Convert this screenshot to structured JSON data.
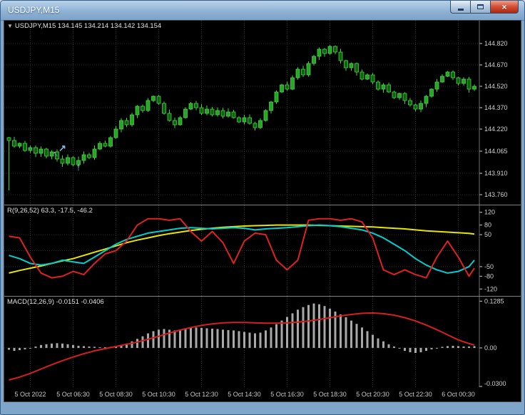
{
  "window": {
    "title": "USDJPY,M15",
    "controls": {
      "minimize": "minimize",
      "maximize": "maximize",
      "close": "close"
    }
  },
  "icons": {
    "symbol_dropdown": "▼",
    "close": "×"
  },
  "main_chart": {
    "label": "USDJPY,M15 134.145 134.214 134.142 134.154",
    "price_axis": [
      "144.820",
      "144.670",
      "144.520",
      "144.370",
      "144.220",
      "144.065",
      "143.910",
      "143.760"
    ]
  },
  "indicators": {
    "r_panel": {
      "label": "R(9,26,52) 63.3, -17.5, -46.2",
      "axis": [
        "120",
        "80",
        "50",
        "-50",
        "-80",
        "-120"
      ]
    },
    "macd_panel": {
      "label": "MACD(12,26,9) -0.0151 -0.0406",
      "axis": [
        {
          "text": "0.1285",
          "value": 0.1285
        },
        {
          "text": "0.00",
          "value": 0.0
        },
        {
          "text": "-0.0300",
          "value": -0.03,
          "pin": "bottom"
        }
      ]
    }
  },
  "time_axis": {
    "labels": [
      {
        "text": "5 Oct 2022",
        "idx": 4
      },
      {
        "text": "5 Oct 06:30",
        "idx": 12
      },
      {
        "text": "5 Oct 08:30",
        "idx": 20
      },
      {
        "text": "5 Oct 10:30",
        "idx": 28
      },
      {
        "text": "5 Oct 12:30",
        "idx": 36
      },
      {
        "text": "5 Oct 14:30",
        "idx": 44
      },
      {
        "text": "5 Oct 16:30",
        "idx": 52
      },
      {
        "text": "5 Oct 18:30",
        "idx": 60
      },
      {
        "text": "5 Oct 20:30",
        "idx": 68
      },
      {
        "text": "5 Oct 22:30",
        "idx": 76
      },
      {
        "text": "6 Oct 00:30",
        "idx": 84
      }
    ]
  },
  "chart_data": [
    {
      "type": "candlestick",
      "title": "USDJPY M15",
      "ylim": [
        143.72,
        144.96
      ],
      "open0": 144.16,
      "first_candle_low": 143.79,
      "closes": [
        144.14,
        144.1,
        144.12,
        144.07,
        144.09,
        144.05,
        144.08,
        144.03,
        144.06,
        144.01,
        143.98,
        144.02,
        143.97,
        144.0,
        144.04,
        144.02,
        144.08,
        144.12,
        144.1,
        144.16,
        144.22,
        144.28,
        144.25,
        144.32,
        144.38,
        144.35,
        144.42,
        144.45,
        144.4,
        144.33,
        144.28,
        144.25,
        144.3,
        144.36,
        144.4,
        144.37,
        144.33,
        144.36,
        144.32,
        144.35,
        144.31,
        144.34,
        144.3,
        144.27,
        144.3,
        144.26,
        144.23,
        144.28,
        144.35,
        144.41,
        144.48,
        144.53,
        144.5,
        144.58,
        144.64,
        144.6,
        144.68,
        144.73,
        144.78,
        144.75,
        144.8,
        144.76,
        144.7,
        144.65,
        144.68,
        144.62,
        144.57,
        144.6,
        144.55,
        144.5,
        144.53,
        144.48,
        144.44,
        144.47,
        144.42,
        144.39,
        144.36,
        144.4,
        144.45,
        144.5,
        144.55,
        144.59,
        144.62,
        144.58,
        144.54,
        144.57,
        144.5,
        144.52
      ],
      "markers": [
        {
          "idx": 10,
          "price": 144.065,
          "glyph": "↗",
          "rotate": 0,
          "size": 13
        },
        {
          "idx": 9,
          "price": 144.03,
          "glyph": "↑",
          "rotate": -35,
          "size": 13
        },
        {
          "idx": 13,
          "price": 143.93,
          "glyph": "↑",
          "rotate": 0,
          "size": 15
        }
      ]
    },
    {
      "type": "line",
      "name": "R(9,26,52)",
      "ylim": [
        -135,
        135
      ],
      "step": 2,
      "levels": [
        50,
        0,
        -50
      ],
      "series": [
        {
          "name": "r-slow",
          "color_key": "r_slow",
          "values": [
            -70,
            -62,
            -55,
            -48,
            -40,
            -32,
            -25,
            -15,
            -5,
            5,
            15,
            25,
            33,
            40,
            47,
            53,
            58,
            63,
            67,
            70,
            73,
            75,
            77,
            78,
            79,
            80,
            80,
            80,
            80,
            79,
            78,
            77,
            76,
            75,
            74,
            72,
            70,
            68,
            65,
            62,
            60,
            58,
            56,
            54,
            52
          ]
        },
        {
          "name": "r-mid",
          "color_key": "r_mid",
          "values": [
            -15,
            -25,
            -40,
            -45,
            -40,
            -30,
            -35,
            -40,
            -20,
            0,
            20,
            35,
            45,
            55,
            60,
            65,
            70,
            72,
            70,
            68,
            70,
            72,
            70,
            65,
            68,
            70,
            72,
            75,
            78,
            80,
            78,
            75,
            70,
            65,
            55,
            40,
            20,
            0,
            -25,
            -45,
            -60,
            -70,
            -65,
            -50,
            -30
          ]
        },
        {
          "name": "r-fast",
          "color_key": "r_fast",
          "values": [
            45,
            40,
            -20,
            -70,
            -85,
            -80,
            -65,
            -75,
            -40,
            -10,
            0,
            30,
            80,
            100,
            100,
            95,
            100,
            60,
            30,
            60,
            25,
            -40,
            30,
            55,
            50,
            -30,
            -60,
            -30,
            95,
            100,
            100,
            95,
            100,
            90,
            40,
            -60,
            -75,
            -60,
            -75,
            -85,
            -20,
            30,
            -20,
            -80,
            -55
          ]
        }
      ]
    },
    {
      "type": "bar",
      "name": "MACD(12,26,9)",
      "ylim": [
        -0.102,
        0.135
      ],
      "signal_step": 2,
      "histogram": [
        -0.005,
        -0.008,
        -0.006,
        -0.004,
        0.0,
        0.004,
        0.008,
        0.01,
        0.012,
        0.013,
        0.012,
        0.01,
        0.008,
        0.006,
        0.005,
        0.004,
        0.003,
        0.002,
        0.002,
        0.003,
        0.005,
        0.008,
        0.012,
        0.018,
        0.025,
        0.032,
        0.04,
        0.046,
        0.05,
        0.052,
        0.05,
        0.048,
        0.05,
        0.053,
        0.055,
        0.056,
        0.055,
        0.054,
        0.053,
        0.052,
        0.05,
        0.049,
        0.048,
        0.046,
        0.044,
        0.042,
        0.04,
        0.042,
        0.048,
        0.056,
        0.065,
        0.075,
        0.085,
        0.095,
        0.105,
        0.112,
        0.118,
        0.122,
        0.12,
        0.115,
        0.108,
        0.1,
        0.092,
        0.084,
        0.075,
        0.066,
        0.056,
        0.046,
        0.036,
        0.026,
        0.018,
        0.01,
        0.004,
        -0.002,
        -0.008,
        -0.012,
        -0.014,
        -0.012,
        -0.008,
        -0.004,
        0.0,
        0.003,
        0.005,
        0.006,
        0.005,
        0.004,
        0.004,
        0.005
      ],
      "signal": [
        -0.088,
        -0.08,
        -0.07,
        -0.058,
        -0.046,
        -0.035,
        -0.025,
        -0.016,
        -0.008,
        -0.002,
        0.004,
        0.01,
        0.016,
        0.024,
        0.032,
        0.041,
        0.049,
        0.056,
        0.062,
        0.066,
        0.069,
        0.07,
        0.07,
        0.069,
        0.068,
        0.068,
        0.069,
        0.071,
        0.074,
        0.078,
        0.083,
        0.088,
        0.092,
        0.095,
        0.096,
        0.094,
        0.09,
        0.083,
        0.074,
        0.063,
        0.05,
        0.036,
        0.022,
        0.012,
        0.008
      ]
    }
  ],
  "colors": {
    "bull_fill": "#27a527",
    "bull_stroke": "#4cd84c",
    "bear_fill": "#0c660c",
    "wick": "#3fcf3f",
    "grid": "#2e2e2e",
    "axis_text": "#cfcfcf",
    "scale_line": "#6e6e6e",
    "r_fast": "#dd2222",
    "r_mid": "#00cfcf",
    "r_slow": "#e6e600",
    "macd_hist": "#a8a8a8",
    "macd_signal": "#d42020",
    "marker": "#8ab4dc"
  }
}
